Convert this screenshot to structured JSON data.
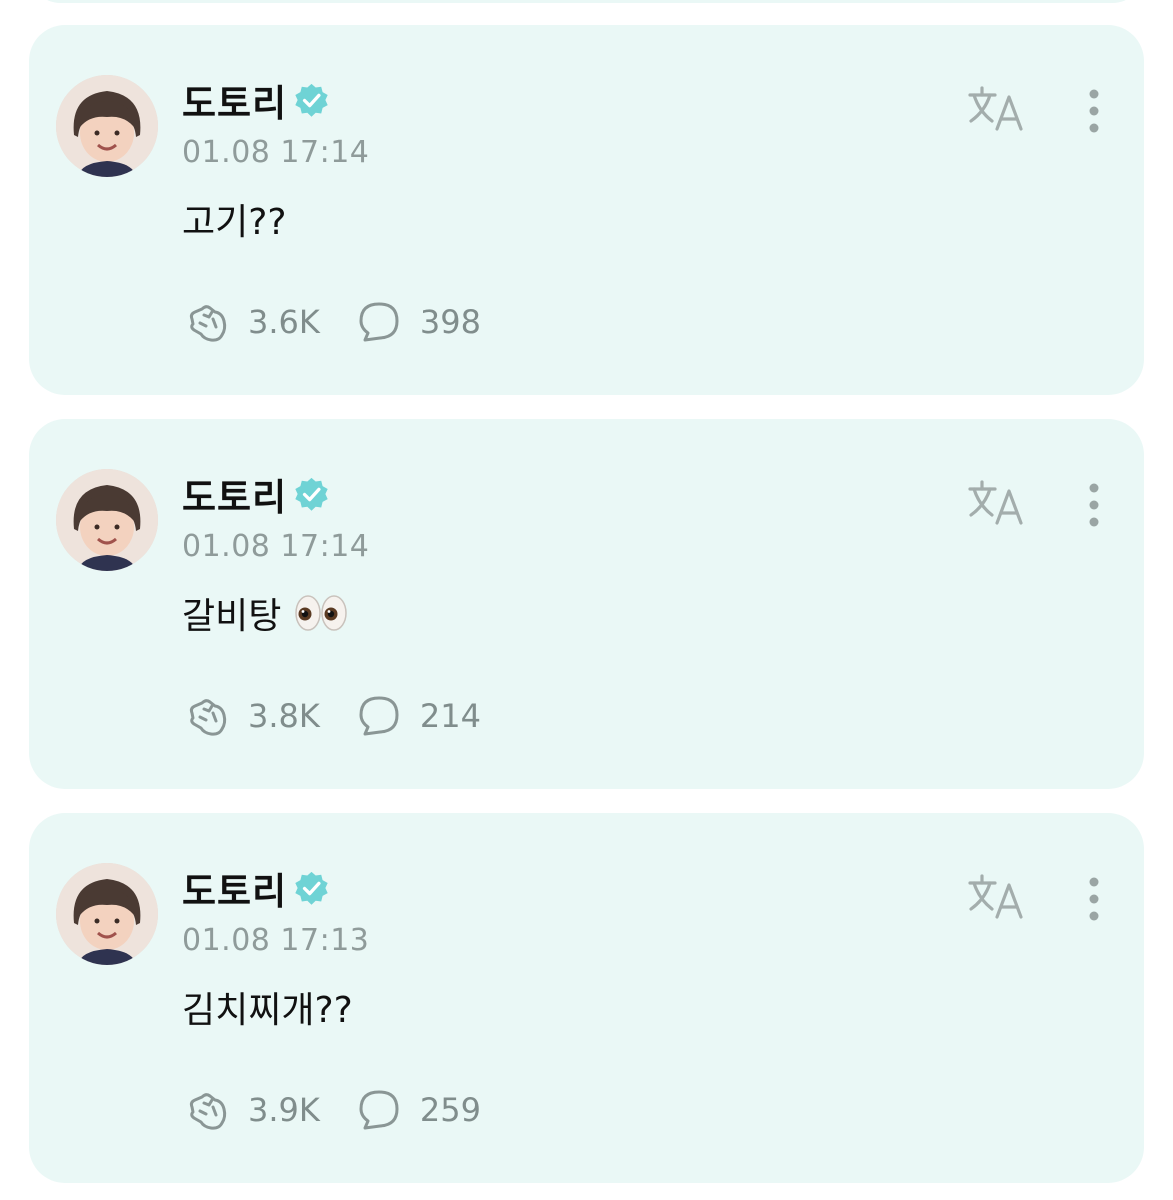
{
  "posts": [
    {
      "author": "도토리",
      "time": "01.08 17:14",
      "text": "고기??",
      "likes": "3.6K",
      "comments": "398",
      "emoji": ""
    },
    {
      "author": "도토리",
      "time": "01.08 17:14",
      "text": "갈비탕",
      "likes": "3.8K",
      "comments": "214",
      "emoji": "eyes"
    },
    {
      "author": "도토리",
      "time": "01.08 17:13",
      "text": "김치찌개??",
      "likes": "3.9K",
      "comments": "259",
      "emoji": ""
    }
  ],
  "colors": {
    "card_background": "#eaf8f6",
    "verified_badge": "#6fd3d5",
    "icon_gray": "#8a9695",
    "timestamp_gray": "#8f9b9a"
  },
  "icons": {
    "verified": "verified-badge-icon",
    "translate": "translate-icon",
    "more": "more-vertical-icon",
    "like": "like-hand-icon",
    "comment": "comment-bubble-icon"
  }
}
